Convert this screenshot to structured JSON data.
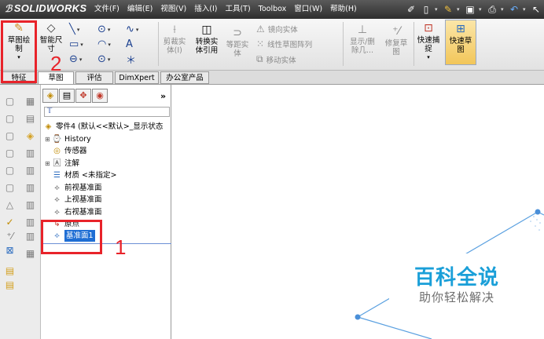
{
  "app": {
    "logo_ds": "ℬ",
    "logo_text": "SOLIDWORKS"
  },
  "menu": [
    "文件(F)",
    "编辑(E)",
    "视图(V)",
    "插入(I)",
    "工具(T)",
    "Toolbox",
    "窗口(W)",
    "帮助(H)"
  ],
  "quick_tools": [
    "pin-icon",
    "new-document-icon",
    "open-icon",
    "save-icon",
    "print-icon",
    "undo-icon",
    "select-icon"
  ],
  "ribbon": {
    "sketch_btn": "草图绘\n制",
    "smart_dim_btn": "智能尺\n寸",
    "trim_btn": "剪裁实\n体(I)",
    "convert_btn": "转换实\n体引用",
    "offset_btn": "等距实\n体",
    "mirror": "镜向实体",
    "linear_pattern": "线性草图阵列",
    "move": "移动实体",
    "show_delete": "显示/删\n除几...",
    "repair": "修复草\n图",
    "quick_snap": "快速捕\n捉",
    "rapid_sketch": "快速草\n图"
  },
  "cm_tabs": [
    "特征",
    "草图",
    "评估",
    "DimXpert",
    "办公室产品"
  ],
  "feature_tree": {
    "filter_symbol": "𝕋",
    "part": "零件4 (默认<<默认>_显示状态",
    "items": [
      "History",
      "传感器",
      "注解",
      "材质 <未指定>",
      "前视基准面",
      "上视基准面",
      "右视基准面",
      "原点",
      "基准面1"
    ]
  },
  "watermark": {
    "main": "百科全说",
    "sub": "助你轻松解决"
  },
  "annotations": {
    "num1": "1",
    "num2": "2"
  },
  "colors": {
    "accent_red": "#e8232a",
    "selection_blue": "#1f6ed4",
    "watermark_blue": "#1a9fd8"
  }
}
